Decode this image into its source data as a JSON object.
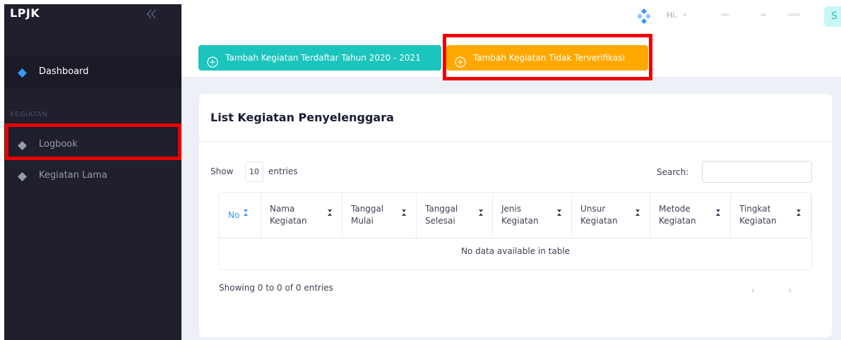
{
  "app": {
    "brand": "LPJK"
  },
  "sidebar": {
    "items": [
      {
        "label": "Dashboard"
      },
      {
        "label": "Logbook"
      },
      {
        "label": "Kegiatan Lama"
      }
    ],
    "section_label": "KEGIATAN"
  },
  "topbar": {
    "greeting": "Hi,",
    "avatar_initial": "S"
  },
  "toolbar": {
    "buttons": [
      {
        "label": "Tambah Kegiatan Terdaftar Tahun 2020 - 2021"
      },
      {
        "label": "Tambah Kegiatan Tidak Terverifikasi"
      }
    ]
  },
  "card": {
    "title": "List Kegiatan Penyelenggara",
    "show_label": "Show",
    "page_size": "10",
    "entries_label": "entries",
    "search_label": "Search:",
    "search_value": "",
    "columns": [
      {
        "line1": "No",
        "line2": ""
      },
      {
        "line1": "Nama",
        "line2": "Kegiatan"
      },
      {
        "line1": "Tanggal",
        "line2": "Mulai"
      },
      {
        "line1": "Tanggal",
        "line2": "Selesai"
      },
      {
        "line1": "Jenis",
        "line2": "Kegiatan"
      },
      {
        "line1": "Unsur",
        "line2": "Kegiatan"
      },
      {
        "line1": "Metode",
        "line2": "Kegiatan"
      },
      {
        "line1": "Tingkat",
        "line2": "Kegiatan"
      }
    ],
    "empty_message": "No data available in table",
    "info": "Showing 0 to 0 of 0 entries",
    "pager": {
      "prev": "‹",
      "next": "›"
    }
  },
  "colors": {
    "sidebar_bg": "#1f1f2d",
    "accent_blue": "#3699ff",
    "teal": "#1bc5bd",
    "orange": "#ffa800",
    "highlight_red": "#ee0000",
    "content_bg": "#eef0f8"
  },
  "icons": [
    "collapse-chevrons-icon",
    "diamond-icon",
    "brand-logo-icon",
    "plus-circle-icon",
    "sort-icon"
  ]
}
